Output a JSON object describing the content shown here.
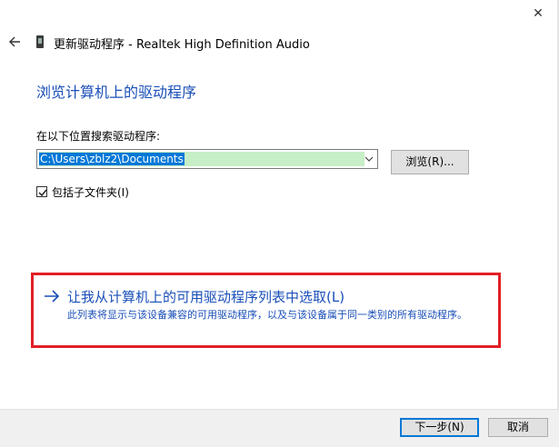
{
  "window": {
    "title": "更新驱动程序 - Realtek High Definition Audio",
    "close_glyph": "✕"
  },
  "page": {
    "heading": "浏览计算机上的驱动程序",
    "search_label": "在以下位置搜索驱动程序:",
    "path_value": "C:\\Users\\zblz2\\Documents",
    "browse_label": "浏览(R)...",
    "include_subfolders_label": "包括子文件夹(I)",
    "include_subfolders_checked": true
  },
  "pick_option": {
    "title": "让我从计算机上的可用驱动程序列表中选取(L)",
    "description": "此列表将显示与该设备兼容的可用驱动程序，以及与该设备属于同一类别的所有驱动程序。"
  },
  "footer": {
    "next_label": "下一步(N)",
    "cancel_label": "取消"
  },
  "colors": {
    "accent": "#1a4fb8",
    "highlight_border": "#e21f26",
    "selection": "#0078d7",
    "autocomplete_bg": "#c7efc7"
  }
}
